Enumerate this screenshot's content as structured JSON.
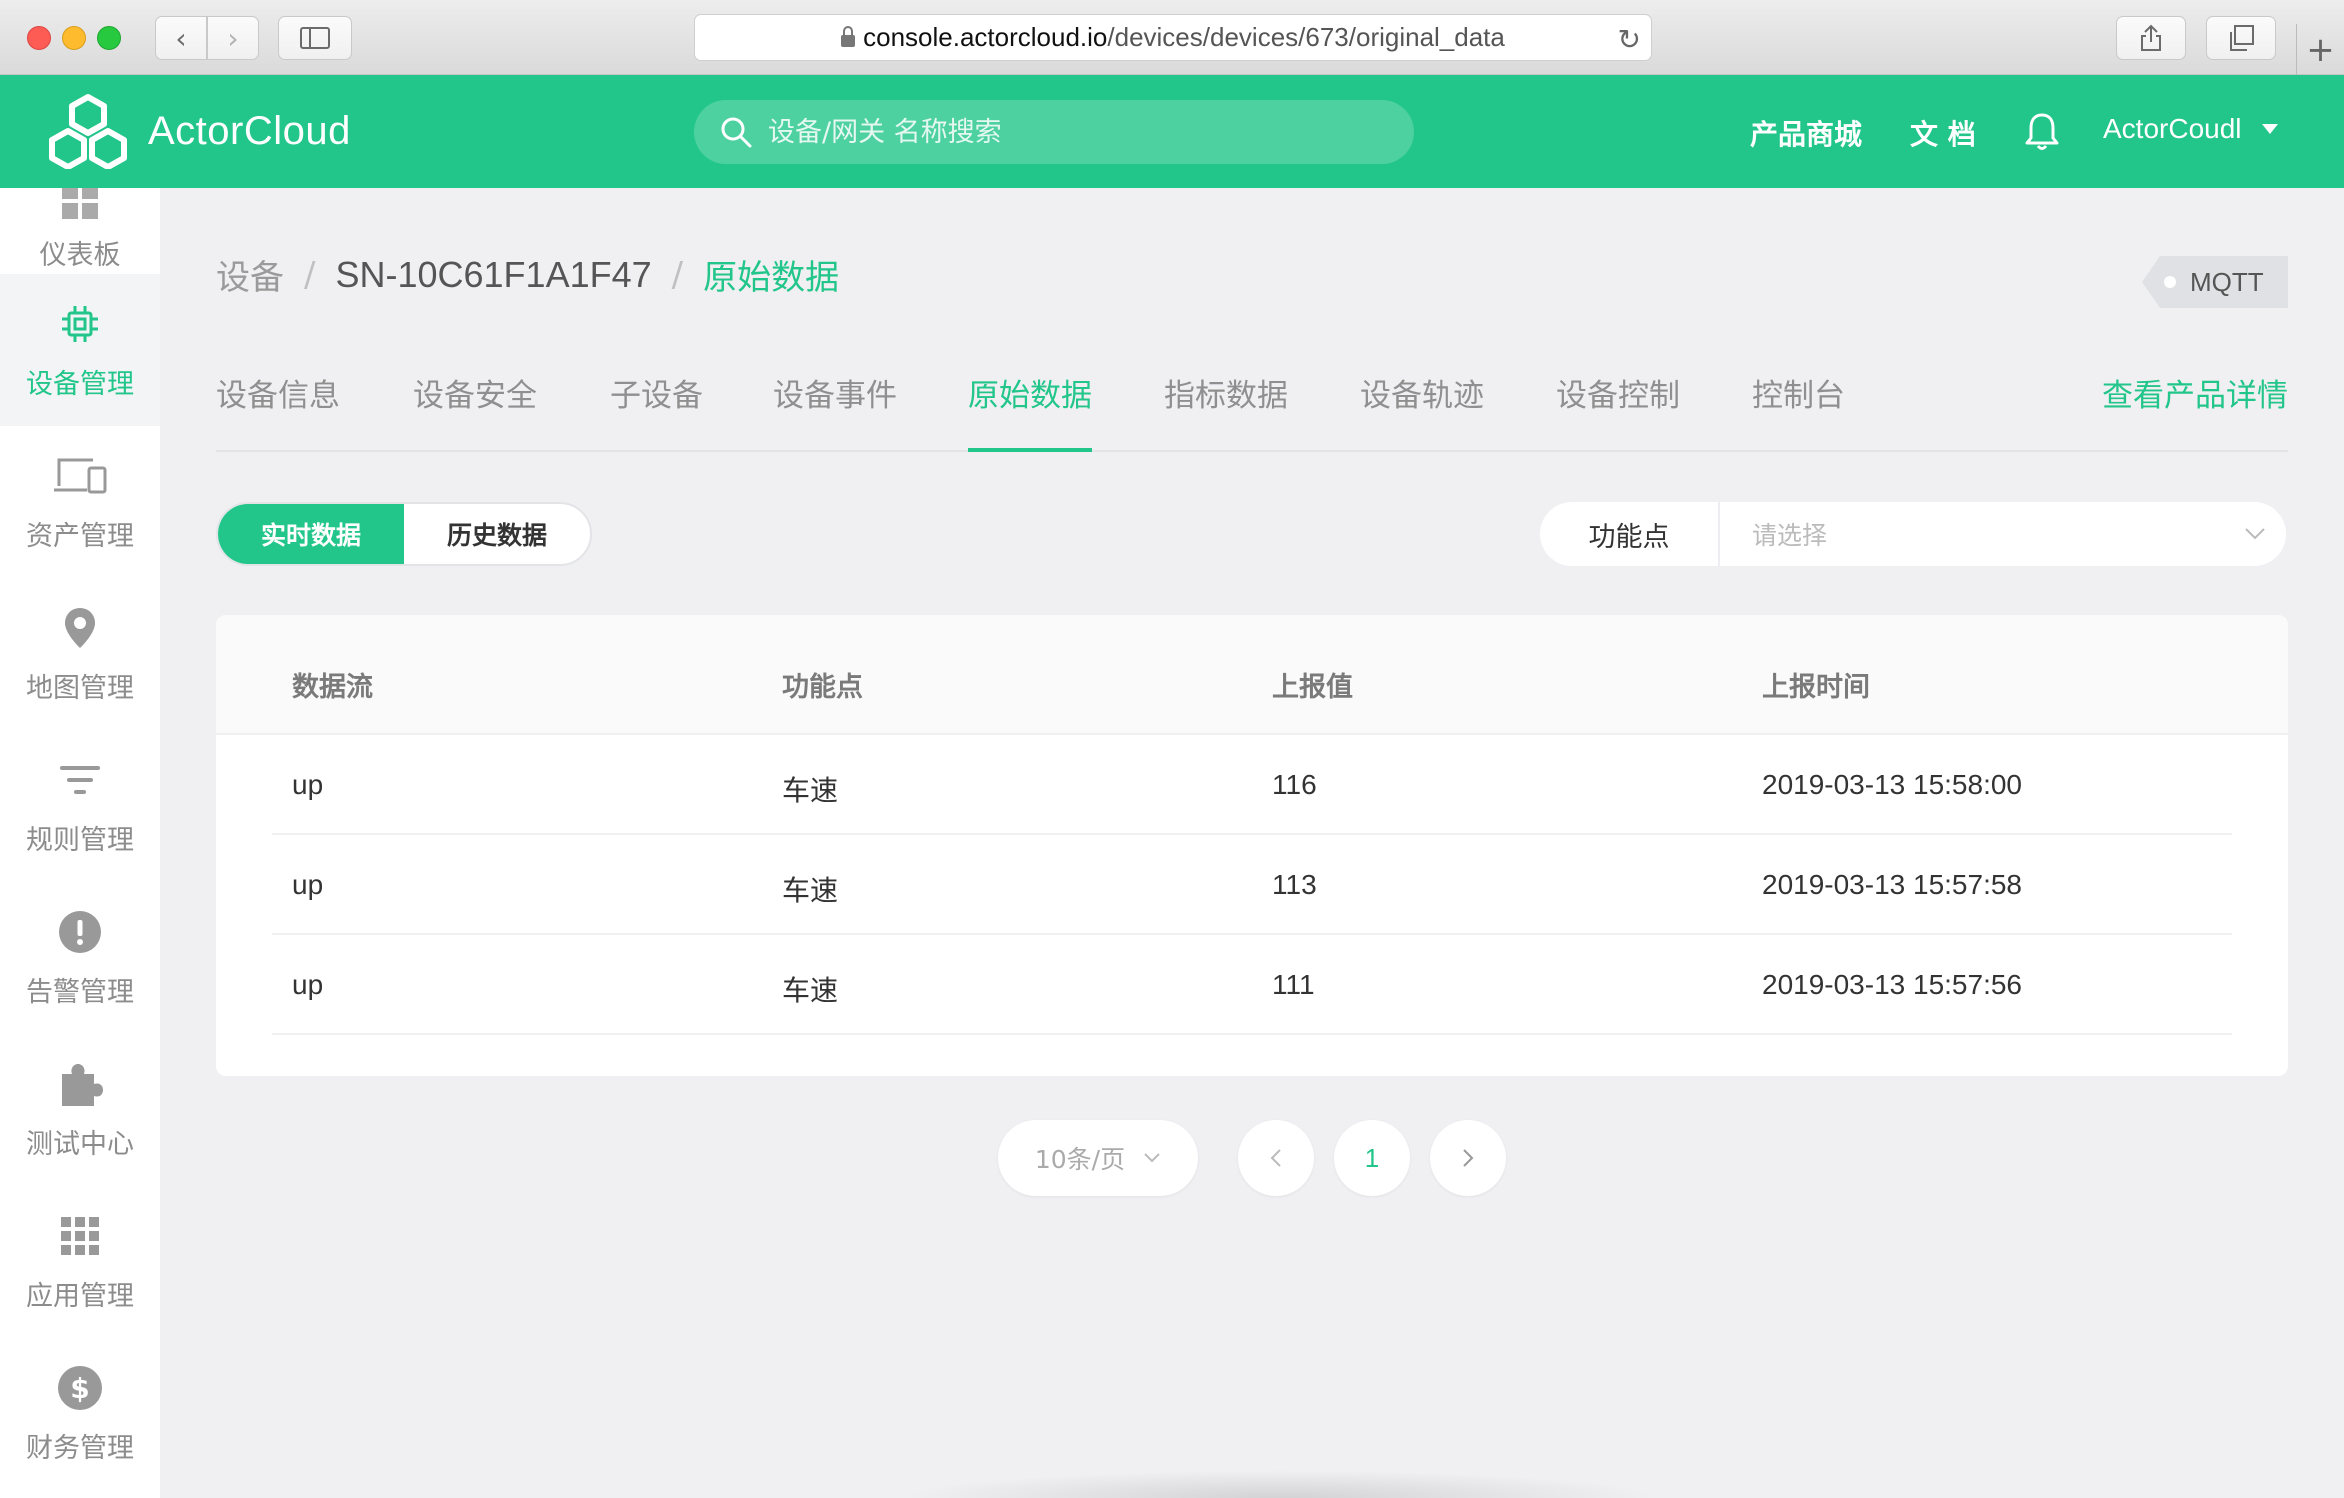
{
  "browser": {
    "url_host": "console.actorcloud.io",
    "url_path": "/devices/devices/673/original_data"
  },
  "header": {
    "logo_text": "ActorCloud",
    "search_placeholder": "设备/网关 名称搜索",
    "nav_store": "产品商城",
    "nav_docs": "文 档",
    "user_name": "ActorCoudl"
  },
  "sidebar": {
    "items": [
      {
        "label": "仪表板",
        "icon": "dashboard-icon"
      },
      {
        "label": "设备管理",
        "icon": "chip-icon"
      },
      {
        "label": "资产管理",
        "icon": "devices-icon"
      },
      {
        "label": "地图管理",
        "icon": "map-pin-icon"
      },
      {
        "label": "规则管理",
        "icon": "filter-icon"
      },
      {
        "label": "告警管理",
        "icon": "alert-icon"
      },
      {
        "label": "测试中心",
        "icon": "puzzle-icon"
      },
      {
        "label": "应用管理",
        "icon": "grid-icon"
      },
      {
        "label": "财务管理",
        "icon": "dollar-icon"
      }
    ]
  },
  "breadcrumb": {
    "root": "设备",
    "sep": "/",
    "device": "SN-10C61F1A1F47",
    "current": "原始数据"
  },
  "protocol_badge": "MQTT",
  "tabs": {
    "items": [
      "设备信息",
      "设备安全",
      "子设备",
      "设备事件",
      "原始数据",
      "指标数据",
      "设备轨迹",
      "设备控制",
      "控制台"
    ],
    "active": "原始数据",
    "product_link": "查看产品详情"
  },
  "segment": {
    "realtime": "实时数据",
    "history": "历史数据"
  },
  "filter": {
    "label": "功能点",
    "placeholder": "请选择"
  },
  "table": {
    "columns": [
      "数据流",
      "功能点",
      "上报值",
      "上报时间"
    ],
    "rows": [
      [
        "up",
        "车速",
        "116",
        "2019-03-13 15:58:00"
      ],
      [
        "up",
        "车速",
        "113",
        "2019-03-13 15:57:58"
      ],
      [
        "up",
        "车速",
        "111",
        "2019-03-13 15:57:56"
      ]
    ]
  },
  "pagination": {
    "page_size": "10条/页",
    "current_page": "1"
  },
  "colors": {
    "brand": "#22c68a",
    "background": "#f0f0f3"
  }
}
